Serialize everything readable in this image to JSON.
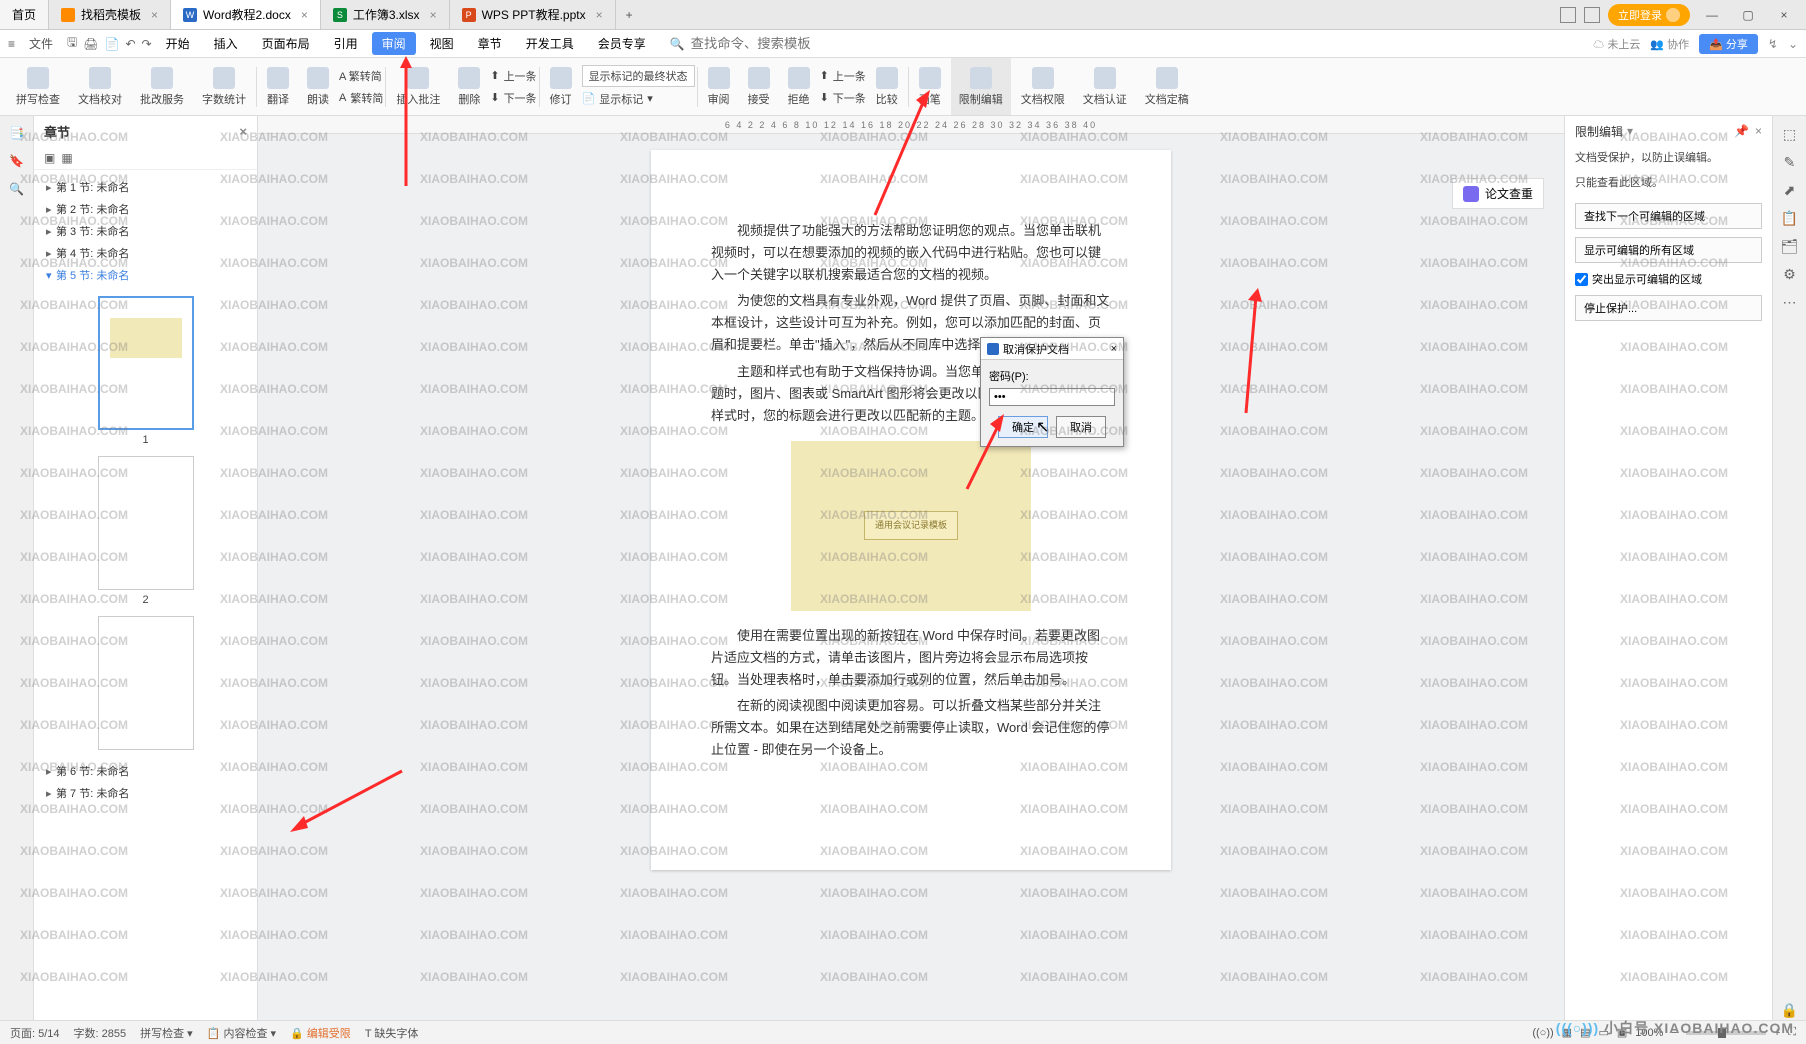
{
  "tabs": {
    "home": "首页",
    "t1": "找稻壳模板",
    "t2": "Word教程2.docx",
    "t3": "工作簿3.xlsx",
    "t4": "WPS PPT教程.pptx"
  },
  "topRight": {
    "login": "立即登录"
  },
  "fileMenu": "文件",
  "menu": {
    "start": "开始",
    "insert": "插入",
    "layout": "页面布局",
    "ref": "引用",
    "review": "审阅",
    "view": "视图",
    "chapter": "章节",
    "dev": "开发工具",
    "member": "会员专享"
  },
  "menuRight": {
    "searchPlaceholder": "查找命令、搜索模板",
    "cloud": "未上云",
    "collab": "协作",
    "share": "分享"
  },
  "ribbon": {
    "spell": "拼写检查",
    "proof": "文档校对",
    "approve": "批改服务",
    "wordcount": "字数统计",
    "translate": "翻译",
    "read": "朗读",
    "trad": "繁转简",
    "insertcomment": "插入批注",
    "delete": "删除",
    "prev_c": "上一条",
    "next_c": "下一条",
    "revision": "修订",
    "markupState": "显示标记的最终状态",
    "showmarkup": "显示标记",
    "review": "审阅",
    "accept": "接受",
    "reject": "拒绝",
    "prev_r": "上一条",
    "next_r": "下一条",
    "compare": "比较",
    "ink": "画笔",
    "restrict": "限制编辑",
    "perm": "文档权限",
    "auth": "文档认证",
    "finalize": "文档定稿"
  },
  "chapterPanel": {
    "title": "章节",
    "items": [
      "第 1 节: 未命名",
      "第 2 节: 未命名",
      "第 3 节: 未命名",
      "第 4 节: 未命名",
      "第 5 节: 未命名",
      "第 6 节: 未命名",
      "第 7 节: 未命名"
    ],
    "thumb1": "1",
    "thumb2": "2"
  },
  "document": {
    "p1": "视频提供了功能强大的方法帮助您证明您的观点。当您单击联机视频时，可以在想要添加的视频的嵌入代码中进行粘贴。您也可以键入一个关键字以联机搜索最适合您的文档的视频。",
    "p2": "为使您的文档具有专业外观，Word 提供了页眉、页脚、封面和文本框设计，这些设计可互为补充。例如，您可以添加匹配的封面、页眉和提要栏。单击\"插入\"，然后从不同库中选择所需元素。",
    "p3": "主题和样式也有助于文档保持协调。当您单击设计并选择新的主题时，图片、图表或 SmartArt 图形将会更改以匹配新的主题。当应用样式时，您的标题会进行更改以匹配新的主题。",
    "diagramLabel": "通用会议记录模板",
    "p4": "使用在需要位置出现的新按钮在 Word 中保存时间。若要更改图片适应文档的方式，请单击该图片，图片旁边将会显示布局选项按钮。当处理表格时，单击要添加行或列的位置，然后单击加号。",
    "p5": "在新的阅读视图中阅读更加容易。可以折叠文档某些部分并关注所需文本。如果在达到结尾处之前需要停止读取，Word 会记住您的停止位置 - 即使在另一个设备上。"
  },
  "lunwen": "论文查重",
  "restrictPanel": {
    "title": "限制编辑",
    "line1": "文档受保护，以防止误编辑。",
    "line2": "只能查看此区域。",
    "btn1": "查找下一个可编辑的区域",
    "btn2": "显示可编辑的所有区域",
    "chk": "突出显示可编辑的区域",
    "btn3": "停止保护..."
  },
  "dialog": {
    "title": "取消保护文档",
    "pwdLabel": "密码(P):",
    "pwdValue": "•••",
    "ok": "确定",
    "cancel": "取消"
  },
  "status": {
    "page": "页面: 5/14",
    "words": "字数: 2855",
    "spellchk": "拼写检查",
    "contentchk": "内容检查",
    "editlimit": "编辑受限",
    "missingfont": "缺失字体",
    "zoom": "100%"
  },
  "watermark": {
    "txt": "XIAOBAIHAO.COM",
    "cn": "小白号"
  },
  "ruler": "6   4   2       2   4   6   8   10   12   14   16   18   20   22   24   26   28   30   32   34   36   38   40"
}
